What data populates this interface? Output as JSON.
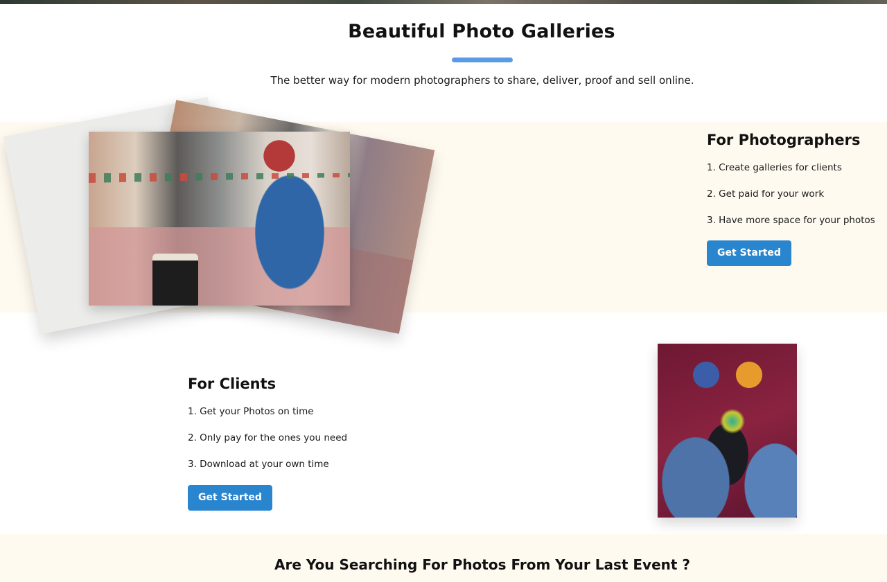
{
  "hero": {
    "title": "Beautiful Photo Galleries",
    "subtitle": "The better way for modern photographers to share, deliver, proof and sell online."
  },
  "photographers": {
    "title": "For Photographers",
    "items": [
      "1. Create galleries for clients",
      "2. Get paid for your work",
      "3. Have more space for your photos"
    ],
    "cta": "Get Started"
  },
  "clients": {
    "title": "For Clients",
    "items": [
      "1. Get your Photos on time",
      "2. Only pay for the ones you need",
      "3. Download at your own time"
    ],
    "cta": "Get Started"
  },
  "bottom": {
    "heading": "Are You Searching For Photos From Your Last Event ?"
  },
  "colors": {
    "accent": "#5b9ae6",
    "button": "#2a85cf",
    "band": "#fffaf0"
  }
}
